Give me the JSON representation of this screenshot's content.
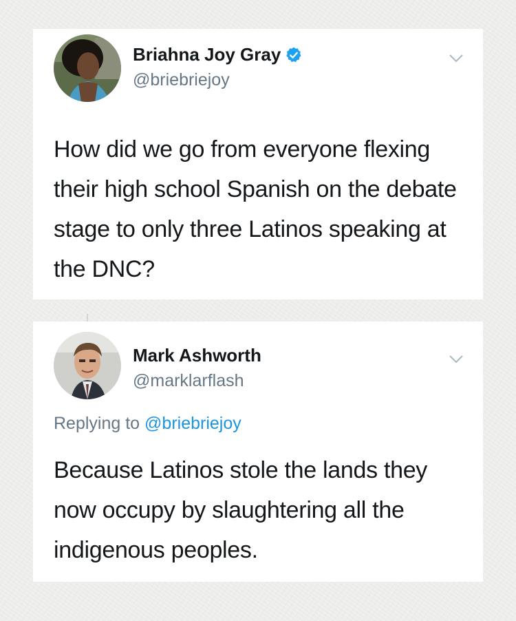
{
  "tweets": [
    {
      "display_name": "Briahna Joy Gray",
      "handle": "@briebriejoy",
      "verified": true,
      "text": "How did we go from everyone flexing their high school Spanish on the debate stage to only three Latinos speaking at the DNC?"
    },
    {
      "display_name": "Mark Ashworth",
      "handle": "@marklarflash",
      "verified": false,
      "replying_to_prefix": "Replying to",
      "replying_to_mention": "@briebriejoy",
      "text": "Because Latinos stole the lands they now occupy by slaughtering all the indigenous peoples."
    }
  ],
  "icons": {
    "verified": "verified-badge-icon",
    "menu": "chevron-down-icon"
  },
  "colors": {
    "background": "#ededeb",
    "card": "#ffffff",
    "text": "#14171a",
    "secondary": "#657786",
    "link": "#1b95e0",
    "verified": "#1da1f2"
  }
}
